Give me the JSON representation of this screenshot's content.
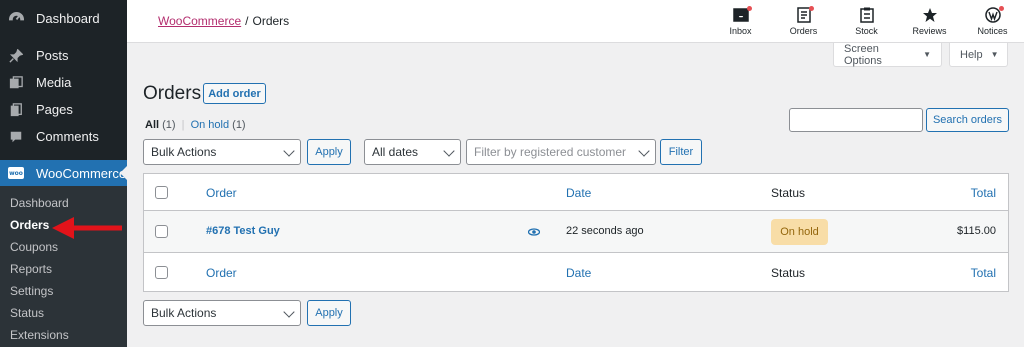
{
  "sidebar": {
    "items": [
      {
        "label": "Dashboard",
        "icon": "dashboard-icon"
      },
      {
        "label": "Posts",
        "icon": "pin-icon"
      },
      {
        "label": "Media",
        "icon": "media-icon"
      },
      {
        "label": "Pages",
        "icon": "pages-icon"
      },
      {
        "label": "Comments",
        "icon": "comment-icon"
      }
    ],
    "woocommerce": {
      "label": "WooCommerce",
      "badge": "woo"
    },
    "submenu": [
      "Dashboard",
      "Orders",
      "Coupons",
      "Reports",
      "Settings",
      "Status",
      "Extensions"
    ],
    "current_submenu": "Orders"
  },
  "header": {
    "breadcrumb_parent": "WooCommerce",
    "breadcrumb_sep": "/",
    "breadcrumb_current": "Orders",
    "icons": [
      {
        "label": "Inbox",
        "icon": "inbox-icon"
      },
      {
        "label": "Orders",
        "icon": "orders-icon"
      },
      {
        "label": "Stock",
        "icon": "stock-icon"
      },
      {
        "label": "Reviews",
        "icon": "star-icon"
      },
      {
        "label": "Notices",
        "icon": "wordpress-icon"
      }
    ]
  },
  "tabs": {
    "screen_options": "Screen Options",
    "help": "Help"
  },
  "page": {
    "title": "Orders",
    "add_button": "Add order",
    "filters": {
      "all_label": "All",
      "all_count": "(1)",
      "sep": "|",
      "onhold_label": "On hold",
      "onhold_count": "(1)"
    },
    "search": {
      "value": "",
      "button": "Search orders"
    },
    "bulk_actions": "Bulk Actions",
    "apply": "Apply",
    "dates": "All dates",
    "customer_placeholder": "Filter by registered customer",
    "filter_button": "Filter"
  },
  "table": {
    "headers": {
      "order": "Order",
      "date": "Date",
      "status": "Status",
      "total": "Total"
    },
    "rows": [
      {
        "order": "#678 Test Guy",
        "date": "22 seconds ago",
        "status": "On hold",
        "total": "$115.00"
      }
    ]
  },
  "colors": {
    "sidebar_bg": "#1d2327",
    "accent": "#2271b1",
    "onhold_bg": "#f8dda7",
    "onhold_text": "#94660c",
    "annotation_arrow": "#e2131a"
  }
}
